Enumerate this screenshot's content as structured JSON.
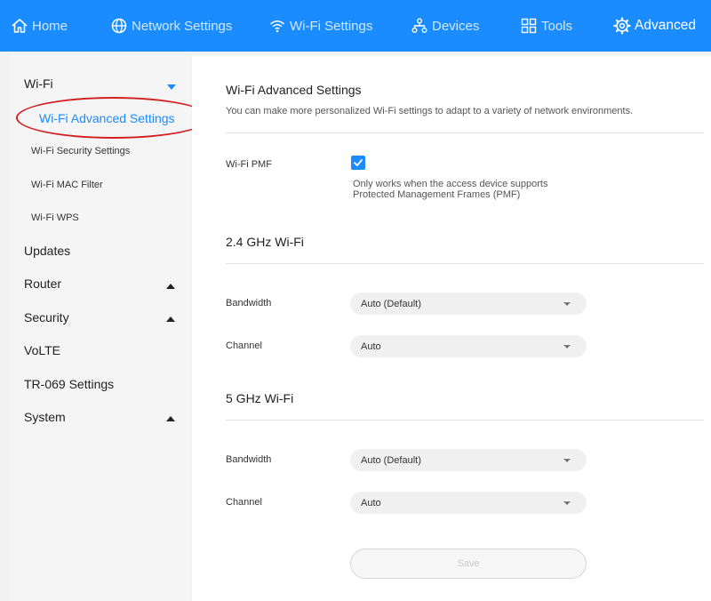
{
  "nav": {
    "items": [
      {
        "label": "Home",
        "icon": "home-icon"
      },
      {
        "label": "Network Settings",
        "icon": "globe-icon"
      },
      {
        "label": "Wi-Fi Settings",
        "icon": "wifi-icon"
      },
      {
        "label": "Devices",
        "icon": "devices-icon"
      },
      {
        "label": "Tools",
        "icon": "tools-icon"
      },
      {
        "label": "Advanced",
        "icon": "gear-icon"
      }
    ],
    "active": "Advanced"
  },
  "sidebar": {
    "wifi_group": {
      "label": "Wi-Fi",
      "items": [
        {
          "label": "Wi-Fi Advanced Settings"
        },
        {
          "label": "Wi-Fi Security Settings"
        },
        {
          "label": "Wi-Fi MAC Filter"
        },
        {
          "label": "Wi-Fi WPS"
        }
      ]
    },
    "groups": [
      {
        "label": "Updates"
      },
      {
        "label": "Router"
      },
      {
        "label": "Security"
      },
      {
        "label": "VoLTE"
      },
      {
        "label": "TR-069 Settings"
      },
      {
        "label": "System"
      }
    ]
  },
  "main": {
    "title": "Wi-Fi Advanced Settings",
    "description": "You can make more personalized Wi-Fi settings to adapt to a variety of network environments.",
    "pmf": {
      "label": "Wi-Fi PMF",
      "checked": true,
      "hint_line1": "Only works when the access device supports",
      "hint_line2": "Protected Management Frames (PMF)"
    },
    "band24": {
      "title": "2.4 GHz Wi-Fi",
      "bandwidth_label": "Bandwidth",
      "bandwidth_value": "Auto (Default)",
      "channel_label": "Channel",
      "channel_value": "Auto"
    },
    "band5": {
      "title": "5 GHz Wi-Fi",
      "bandwidth_label": "Bandwidth",
      "bandwidth_value": "Auto (Default)",
      "channel_label": "Channel",
      "channel_value": "Auto"
    },
    "save_label": "Save"
  },
  "colors": {
    "accent": "#1a8cff",
    "annotation": "#d42020"
  }
}
